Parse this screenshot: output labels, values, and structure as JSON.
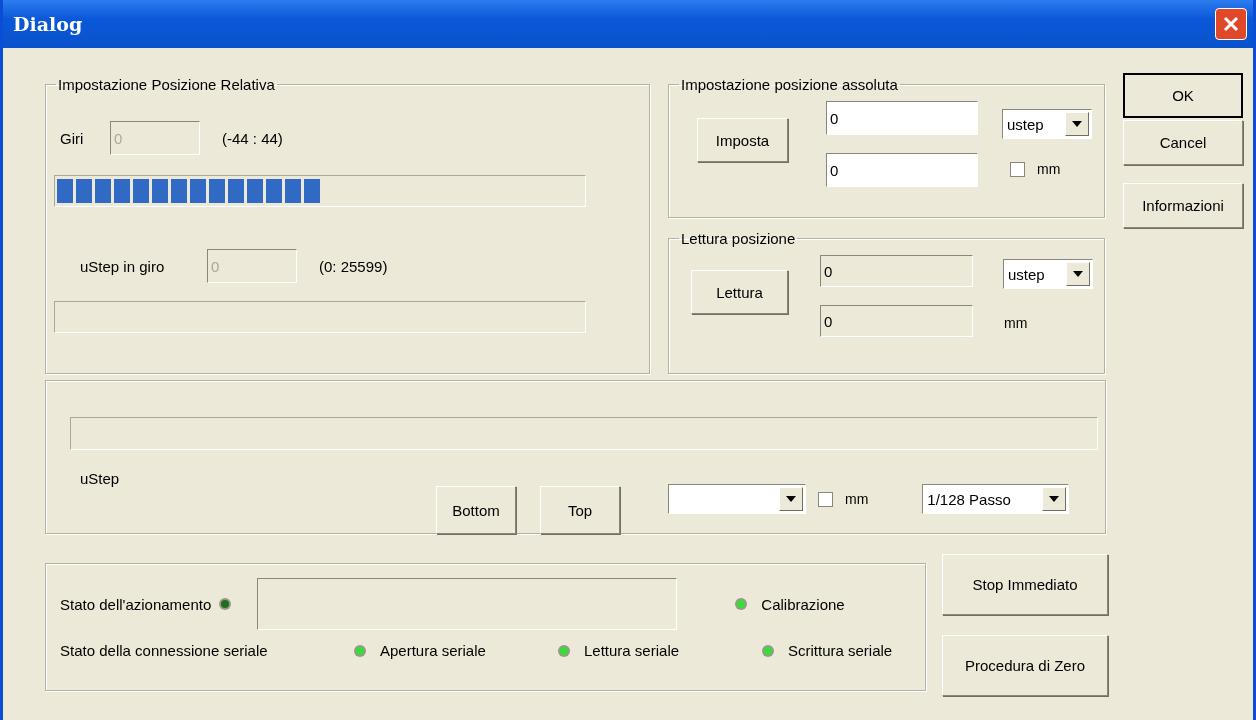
{
  "window": {
    "title": "Dialog"
  },
  "relative": {
    "title": "Impostazione Posizione Relativa",
    "turns": {
      "label": "Giri",
      "value": "0",
      "disabled": true,
      "range": "(-44 : 44)"
    },
    "turns_bar": {
      "level": 0.5
    },
    "ustep": {
      "label": "uStep in giro",
      "value": "0",
      "disabled": true,
      "range": "(0: 25599)"
    },
    "ustep_bar": {
      "level": 0
    }
  },
  "absolute": {
    "title": "Impostazione posizione assoluta",
    "button": "Imposta",
    "value_1": "0",
    "value_2": "0",
    "unit": "ustep",
    "mm_checkbox": {
      "label": "mm",
      "checked": false
    }
  },
  "reading": {
    "title": "Lettura posizione",
    "button": "Lettura",
    "value_1": "0",
    "value_2": "0",
    "unit": "ustep",
    "unit_2": "mm"
  },
  "dialog_buttons": [
    {
      "label": "OK",
      "default": true
    },
    {
      "label": "Cancel",
      "default": false
    },
    {
      "label": "Informazioni",
      "default": false
    }
  ],
  "motion": {
    "bar": {
      "level": 0
    },
    "label": "uStep",
    "buttons": [
      "Bottom",
      "Top"
    ],
    "mm_checkbox": {
      "label": "mm",
      "checked": false
    },
    "division": "1/128 Passo"
  },
  "status": {
    "drive": {
      "label": "Stato dell'azionamento",
      "color": "#1e6e1e"
    },
    "calibration": {
      "label": "Calibrazione",
      "color": "#33e033"
    },
    "serial_label": "Stato della connessione seriale",
    "serial": [
      {
        "label": "Apertura seriale",
        "color": "#33e033"
      },
      {
        "label": "Lettura seriale",
        "color": "#33e033"
      },
      {
        "label": "Scrittura seriale",
        "color": "#33e033"
      }
    ]
  },
  "action_buttons": [
    "Stop Immediato",
    "Procedura di Zero"
  ]
}
